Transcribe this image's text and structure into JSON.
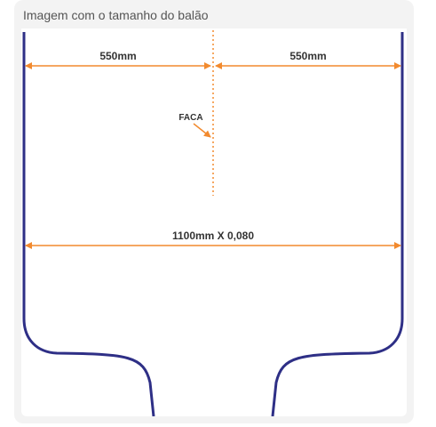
{
  "caption": "Imagem com o tamanho do balão",
  "diagram": {
    "dim_left": "550mm",
    "dim_right": "550mm",
    "knife_label": "FACA",
    "dim_total": "1100mm X 0,080",
    "colors": {
      "outline": "#2e2f86",
      "dimension": "#f28a2e",
      "text": "#333333",
      "panel": "#f3f3f3"
    }
  }
}
